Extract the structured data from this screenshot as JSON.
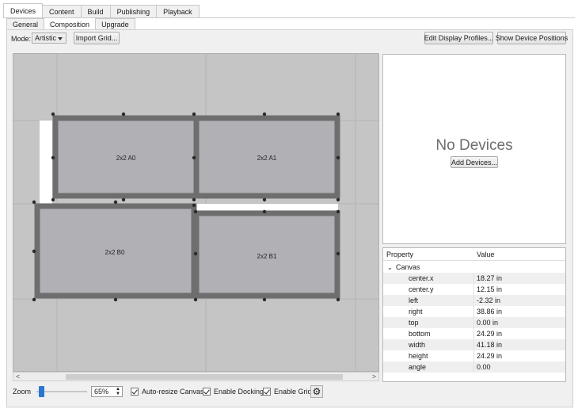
{
  "tabs": [
    "Devices",
    "Content",
    "Build",
    "Publishing",
    "Playback"
  ],
  "subtabs": [
    "General",
    "Composition",
    "Upgrade"
  ],
  "toolbar": {
    "mode_label": "Mode:",
    "mode_value": "Artistic",
    "import_grid": "Import Grid...",
    "edit_profiles": "Edit Display Profiles...",
    "show_positions": "Show Device Positions"
  },
  "canvas": {
    "displays": [
      {
        "label": "2x2 A0"
      },
      {
        "label": "2x2 A1"
      },
      {
        "label": "2x2 B0"
      },
      {
        "label": "2x2 B1"
      }
    ]
  },
  "devices_panel": {
    "title": "No Devices",
    "add_button": "Add Devices..."
  },
  "properties": {
    "col_property": "Property",
    "col_value": "Value",
    "group": "Canvas",
    "rows": [
      {
        "key": "center.x",
        "value": "18.27 in"
      },
      {
        "key": "center.y",
        "value": "12.15 in"
      },
      {
        "key": "left",
        "value": "-2.32 in"
      },
      {
        "key": "right",
        "value": "38.86 in"
      },
      {
        "key": "top",
        "value": "0.00 in"
      },
      {
        "key": "bottom",
        "value": "24.29 in"
      },
      {
        "key": "width",
        "value": "41.18 in"
      },
      {
        "key": "height",
        "value": "24.29 in"
      },
      {
        "key": "angle",
        "value": "0.00"
      }
    ]
  },
  "bottom": {
    "zoom_label": "Zoom",
    "zoom_value": "65%",
    "zoom_level": 0.05,
    "auto_resize": "Auto-resize Canvas",
    "enable_docking": "Enable Docking",
    "enable_grid": "Enable Grid"
  }
}
